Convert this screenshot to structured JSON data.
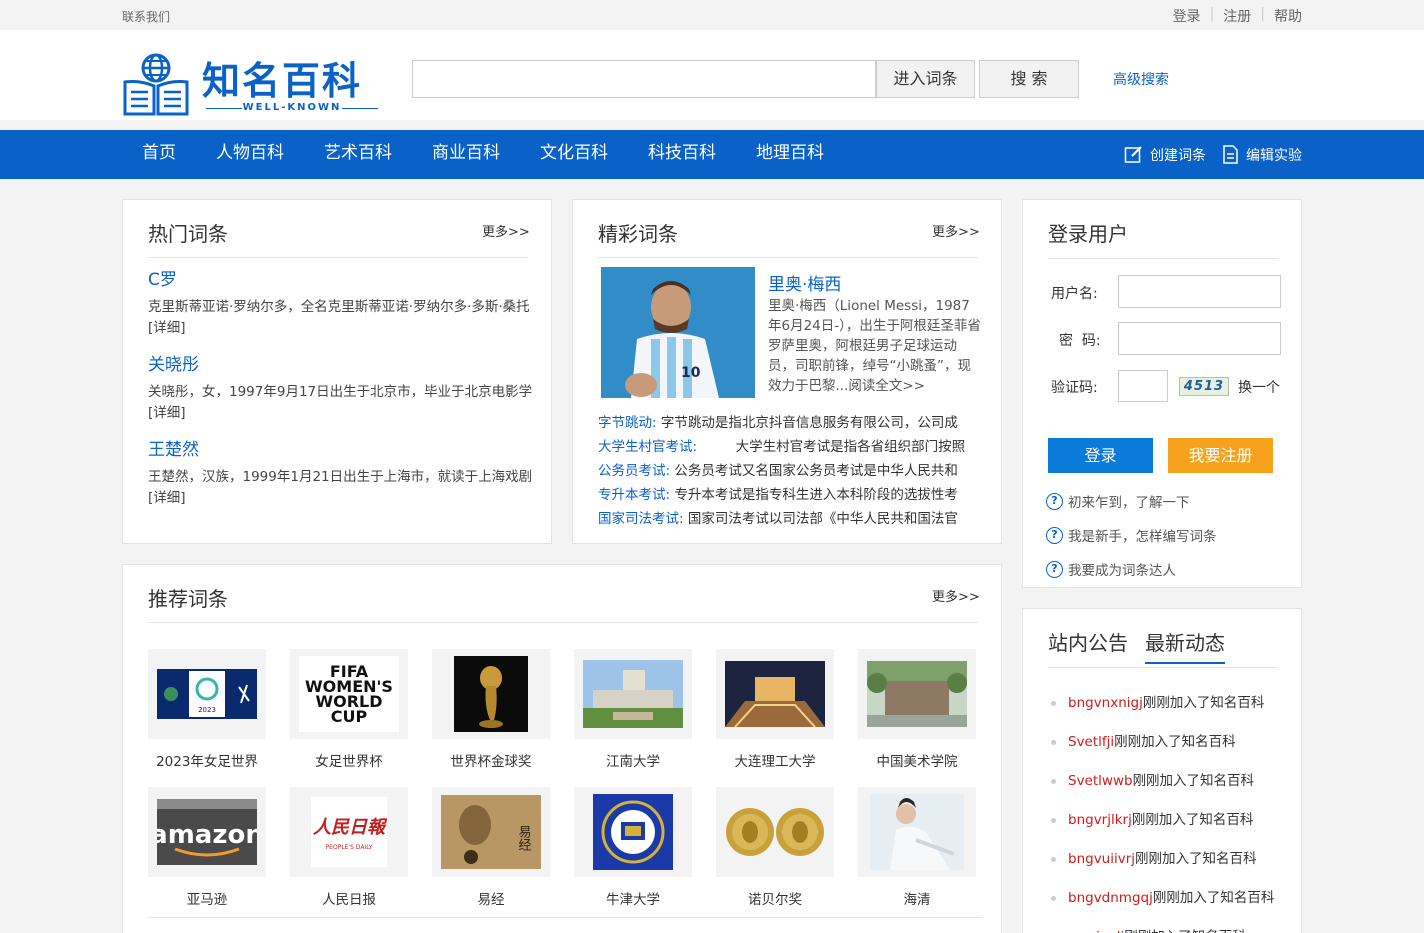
{
  "topbar": {
    "contact": "联系我们",
    "login": "登录",
    "register": "注册",
    "help": "帮助"
  },
  "logo": {
    "title": "知名百科",
    "subtitle": "WELL-KNOWN"
  },
  "search": {
    "placeholder": "",
    "enter_label": "进入词条",
    "search_label": "搜 索",
    "advanced": "高级搜索"
  },
  "nav": {
    "items": [
      "首页",
      "人物百科",
      "艺术百科",
      "商业百科",
      "文化百科",
      "科技百科",
      "地理百科"
    ],
    "create": "创建词条",
    "edit": "编辑实验"
  },
  "hot": {
    "title": "热门词条",
    "more": "更多>>",
    "entries": [
      {
        "title": "C罗",
        "desc": "克里斯蒂亚诺·罗纳尔多，全名克里斯蒂亚诺·罗纳尔多·多斯·桑托[详细]"
      },
      {
        "title": "关晓彤",
        "desc": "关晓彤，女，1997年9月17日出生于北京市，毕业于北京电影学[详细]"
      },
      {
        "title": "王楚然",
        "desc": "王楚然，汉族，1999年1月21日出生于上海市，就读于上海戏剧[详细]"
      }
    ]
  },
  "featured": {
    "title": "精彩词条",
    "more": "更多>>",
    "main_title": "里奥·梅西",
    "main_desc": "里奥·梅西（Lionel Messi，1987年6月24日-），出生于阿根廷圣菲省罗萨里奥，阿根廷男子足球运动员，司职前锋，绰号“小跳蚤”，现效力于巴黎...阅读全文>>",
    "rows": [
      {
        "key": "字节跳动:",
        "text": " 字节跳动是指北京抖音信息服务有限公司，公司成"
      },
      {
        "key": "大学生村官考试:",
        "text": "         大学生村官考试是指各省组织部门按照"
      },
      {
        "key": "公务员考试:",
        "text": " 公务员考试又名国家公务员考试是中华人民共和"
      },
      {
        "key": "专升本考试:",
        "text": " 专升本考试是指专科生进入本科阶段的选拔性考"
      },
      {
        "key": "国家司法考试:",
        "text": " 国家司法考试以司法部《中华人民共和国法官"
      }
    ]
  },
  "login": {
    "title": "登录用户",
    "username_label": "用户名:",
    "password_label": "密  码:",
    "captcha_label": "验证码:",
    "captcha_code": "4513",
    "captcha_refresh": "换一个",
    "login_btn": "登录",
    "register_btn": "我要注册",
    "help": [
      "初来乍到，了解一下",
      "我是新手，怎样编写词条",
      "我要成为词条达人"
    ]
  },
  "recommend": {
    "title": "推荐词条",
    "more": "更多>>",
    "items": [
      "2023年女足世界",
      "女足世界杯",
      "世界杯金球奖",
      "江南大学",
      "大连理工大学",
      "中国美术学院",
      "亚马逊",
      "人民日报",
      "易经",
      "牛津大学",
      "诺贝尔奖",
      "海清"
    ],
    "thumb_text": {
      "fifa": "FIFA WOMEN'S WORLD CUP",
      "fifa_2023": "2023",
      "amazon": "amazon",
      "people": "人民日報",
      "people_en": "PEOPLE'S DAILY",
      "yijing": "易经"
    }
  },
  "notice": {
    "tab1": "站内公告",
    "tab2": "最新动态",
    "suffix": "刚刚加入了知名百科",
    "users": [
      "bngvnxnigj",
      "Svetlfji",
      "Svetlwwb",
      "bngvrjlkrj",
      "bngvuiivrj",
      "bngvdnmgqj",
      "wuqianli"
    ]
  }
}
